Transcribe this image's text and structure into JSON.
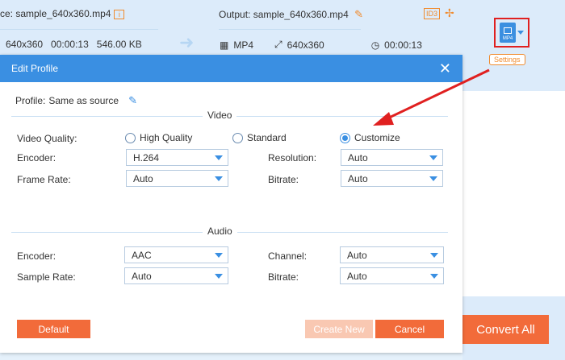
{
  "source": {
    "name": "ce: sample_640x360.mp4",
    "resolution": "640x360",
    "duration": "00:00:13",
    "size": "546.00 KB"
  },
  "output": {
    "name": "Output: sample_640x360.mp4",
    "format": "MP4",
    "resolution": "640x360",
    "duration": "00:00:13",
    "id3_label": "ID3"
  },
  "settings": {
    "badge_label": "MP4",
    "tooltip": "Settings"
  },
  "convert_all": "Convert All",
  "dialog": {
    "title": "Edit Profile",
    "close": "✕",
    "profile_label": "Profile:",
    "profile_value": "Same as source",
    "video": {
      "section": "Video",
      "quality_label": "Video Quality:",
      "quality_options": [
        "High Quality",
        "Standard",
        "Customize"
      ],
      "quality_selected": "Customize",
      "encoder_label": "Encoder:",
      "encoder_value": "H.264",
      "resolution_label": "Resolution:",
      "resolution_value": "Auto",
      "framerate_label": "Frame Rate:",
      "framerate_value": "Auto",
      "bitrate_label": "Bitrate:",
      "bitrate_value": "Auto"
    },
    "audio": {
      "section": "Audio",
      "encoder_label": "Encoder:",
      "encoder_value": "AAC",
      "channel_label": "Channel:",
      "channel_value": "Auto",
      "samplerate_label": "Sample Rate:",
      "samplerate_value": "Auto",
      "bitrate_label": "Bitrate:",
      "bitrate_value": "Auto"
    },
    "buttons": {
      "default": "Default",
      "create_new": "Create New",
      "cancel": "Cancel"
    }
  },
  "colors": {
    "accent_blue": "#3a8fe2",
    "accent_orange": "#f26b3a",
    "highlight_red": "#e02020"
  }
}
